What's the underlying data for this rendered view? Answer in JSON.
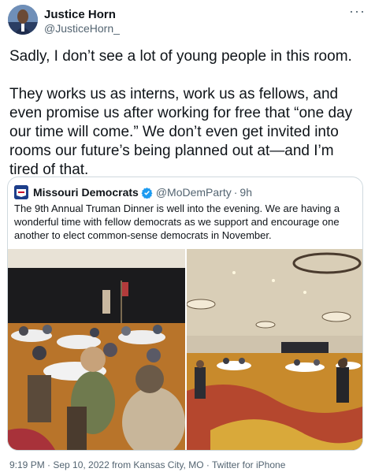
{
  "author": {
    "name": "Justice Horn",
    "handle": "@JusticeHorn_"
  },
  "menu_icon": "more-horizontal-icon",
  "tweet": {
    "paragraphs": [
      "Sadly, I don’t see a lot of young people in this room.",
      "They works us as interns, work us as fellows, and even promise us after working for free that “one day our time will come.” We don’t even get invited into rooms our future’s being planned out at—and I’m tired of that."
    ]
  },
  "quote": {
    "name": "Missouri Democrats",
    "handle": "@MoDemParty",
    "separator": "·",
    "time": "9h",
    "text": "The 9th Annual Truman Dinner is well into the evening. We are having a wonderful time with fellow democrats as we support and encourage one another to elect common-sense democrats in November.",
    "verified_icon": "verified-badge-icon"
  },
  "footer": {
    "meta": "9:19 PM · Sep 10, 2022 from Kansas City, MO · Twitter for iPhone"
  },
  "colors": {
    "verified": "#1d9bf0",
    "secondary_text": "#536471",
    "border": "#cfd9de"
  }
}
